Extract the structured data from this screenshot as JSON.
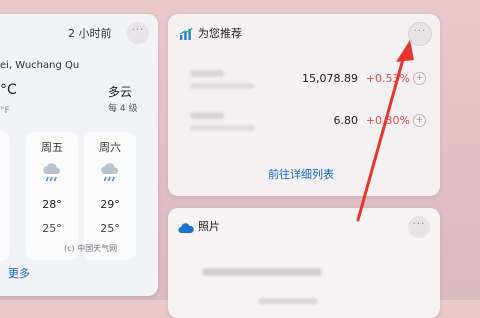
{
  "weather": {
    "updated": "2 小时前",
    "location": "ei, Wuchang Qu",
    "temp_unit": "°C",
    "f_unit": "°F",
    "condition": "多云",
    "condition_sub": "每 4 级",
    "more_button": "···",
    "days": [
      {
        "name": "",
        "hi": "°",
        "lo": "°"
      },
      {
        "name": "周五",
        "hi": "28°",
        "lo": "25°"
      },
      {
        "name": "周六",
        "hi": "29°",
        "lo": "25°"
      }
    ],
    "source": "(c) 中国天气网",
    "more_link": "更多"
  },
  "recommend": {
    "title": "为您推荐",
    "more_button": "···",
    "stocks": [
      {
        "price": "15,078.89",
        "change": "+0.53%"
      },
      {
        "price": "6.80",
        "change": "+0.30%"
      }
    ],
    "link": "前往详细列表",
    "colors": {
      "up": "#e14a4a",
      "link": "#1a66c9"
    }
  },
  "photos": {
    "title": "照片",
    "more_button": "···"
  },
  "annotation": {
    "color": "#e8342f"
  }
}
